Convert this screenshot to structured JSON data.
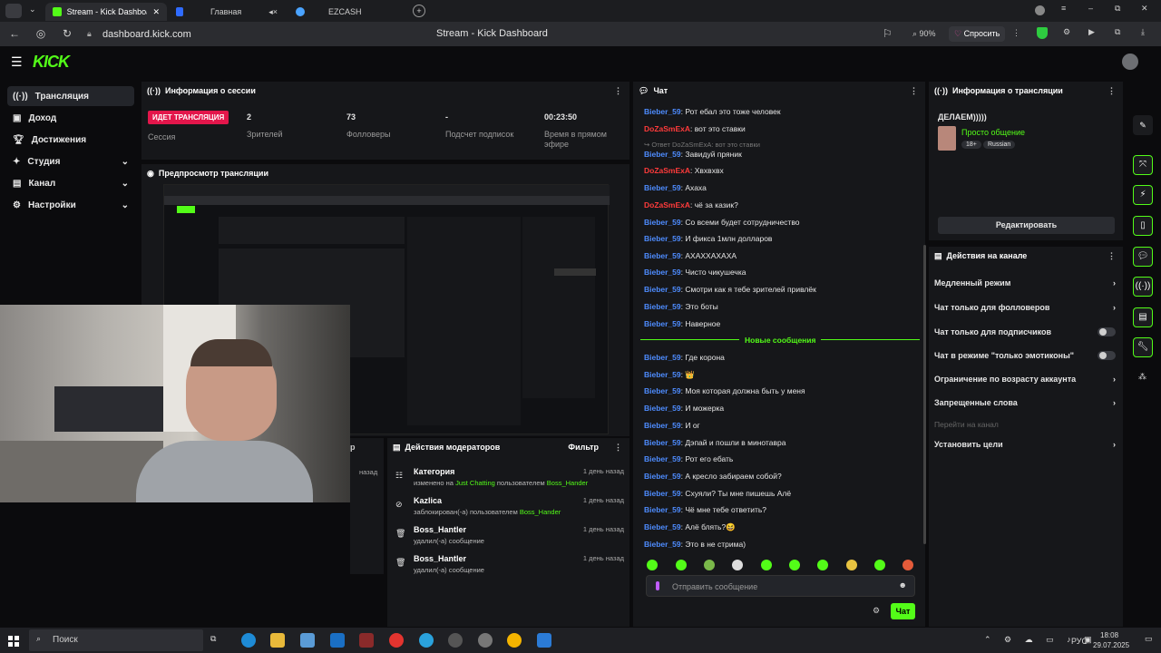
{
  "browser": {
    "tabs": [
      {
        "label": "Stream - Kick Dashboard"
      },
      {
        "label": "Главная"
      },
      {
        "label": "EZCASH"
      }
    ],
    "url": "dashboard.kick.com",
    "page_title": "Stream - Kick Dashboard",
    "zoom": "90%",
    "ask_label": "Спросить"
  },
  "sidebar": {
    "logo": "KICK",
    "items": [
      {
        "label": "Трансляция"
      },
      {
        "label": "Доход"
      },
      {
        "label": "Достижения"
      },
      {
        "label": "Студия"
      },
      {
        "label": "Канал"
      },
      {
        "label": "Настройки"
      }
    ]
  },
  "session": {
    "title": "Информация о сессии",
    "live_badge": "ИДЕТ ТРАНСЛЯЦИЯ",
    "session_label": "Сессия",
    "viewers_value": "2",
    "viewers_label": "Зрителей",
    "followers_value": "73",
    "followers_label": "Фолловеры",
    "subs_value": "-",
    "subs_label": "Подсчет подписок",
    "time_value": "00:23:50",
    "time_label": "Время в прямом эфире"
  },
  "preview": {
    "title": "Предпросмотр трансляции"
  },
  "chat": {
    "title": "Чат",
    "messages": [
      {
        "user": "Bieber_59",
        "text": ": Рот ебал это тоже человек"
      },
      {
        "user": "DoZaSmExA",
        "text": ": вот это ставки"
      },
      {
        "user": "",
        "text": "↪ Ответ DoZaSmExA: вот это ставки"
      },
      {
        "user": "Bieber_59",
        "text": ": Завидуй пряник"
      },
      {
        "user": "DoZaSmExA",
        "text": ": Хвхвхвх"
      },
      {
        "user": "Bieber_59",
        "text": ": Ахаха"
      },
      {
        "user": "DoZaSmExA",
        "text": ": чё за казик?"
      },
      {
        "user": "Bieber_59",
        "text": ": Со всеми будет сотрудничество"
      },
      {
        "user": "Bieber_59",
        "text": ": И фикса 1млн долларов"
      },
      {
        "user": "Bieber_59",
        "text": ": АХАХХАХАХА"
      },
      {
        "user": "Bieber_59",
        "text": ": Чисто чикушечка"
      },
      {
        "user": "Bieber_59",
        "text": ": Смотри как я тебе зрителей привлёк"
      },
      {
        "user": "Bieber_59",
        "text": ": Это боты"
      },
      {
        "user": "Bieber_59",
        "text": ": Наверное"
      }
    ],
    "new_messages": "Новые сообщения",
    "messages2": [
      {
        "user": "Bieber_59",
        "text": ": Где корона"
      },
      {
        "user": "Bieber_59",
        "text": ": 👑"
      },
      {
        "user": "Bieber_59",
        "text": ": Моя которая должна быть у меня"
      },
      {
        "user": "Bieber_59",
        "text": ": И можерка"
      },
      {
        "user": "Bieber_59",
        "text": ": И ог"
      },
      {
        "user": "Bieber_59",
        "text": ": Дэпай и пошли в минотавра"
      },
      {
        "user": "Bieber_59",
        "text": ": Рот его ебать"
      },
      {
        "user": "Bieber_59",
        "text": ": А кресло забираем собой?"
      },
      {
        "user": "Bieber_59",
        "text": ": Схуяли? Ты мне пишешь Алё"
      },
      {
        "user": "Bieber_59",
        "text": ": Чё мне тебе ответить?"
      },
      {
        "user": "Bieber_59",
        "text": ": Алё блять?😆"
      },
      {
        "user": "Bieber_59",
        "text": ": Это в не стрима)"
      }
    ],
    "input_placeholder": "Отправить сообщение",
    "send_label": "Чат"
  },
  "mod": {
    "title": "Действия модераторов",
    "filter": "Фильтр",
    "rows": [
      {
        "title": "Категория",
        "sub_a": "изменено на ",
        "sub_b": "Just Chatting",
        "sub_c": " пользователем ",
        "sub_d": "Boss_Hander",
        "time": "1 день назад"
      },
      {
        "title": "Kazlica",
        "sub_a": "заблокирован(-а) пользователем ",
        "sub_b": "Boss_Hander",
        "time": "1 день назад"
      },
      {
        "title": "Boss_Hantler",
        "sub_a": "удалил(-а) сообщение",
        "time": "1 день назад"
      },
      {
        "title": "Boss_Hantler",
        "sub_a": "удалил(-а) сообщение",
        "time": "1 день назад"
      }
    ],
    "left_time": "назад"
  },
  "stream_info": {
    "title": "Информация о трансляции",
    "stream_title": "ДЕЛАЕМ)))))",
    "category": "Просто общение",
    "tag1": "18+",
    "tag2": "Russian",
    "edit_label": "Редактировать"
  },
  "channel_actions": {
    "title": "Действия на канале",
    "slow_mode": "Медленный режим",
    "followers_only": "Чат только для фолловеров",
    "subs_only": "Чат только для подписчиков",
    "emotes_only": "Чат в режиме \"только эмотиконы\"",
    "age_limit": "Ограничение по возрасту аккаунта",
    "banned_words": "Запрещенные слова",
    "go_channel": "Перейти на канал",
    "set_goal": "Установить цели"
  },
  "taskbar": {
    "search": "Поиск",
    "lang": "РУС",
    "time": "18:08",
    "date": "29.07.2025"
  },
  "colors": {
    "accent": "#53fc18",
    "live": "#e3164b",
    "user": "#4e8cff",
    "user2": "#ff3b3b"
  }
}
